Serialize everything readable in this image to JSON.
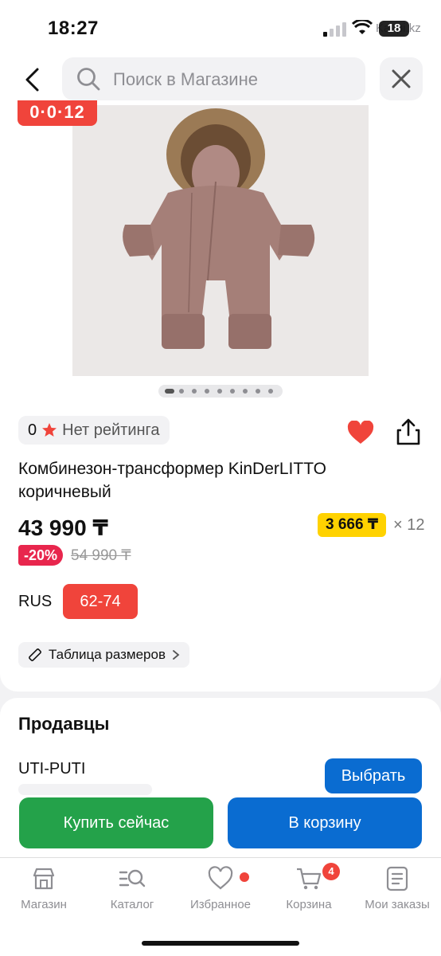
{
  "status_bar": {
    "time": "18:27",
    "carrier": "Kaspi.kz",
    "battery": "18"
  },
  "header": {
    "search_placeholder": "Поиск в Магазине"
  },
  "gallery": {
    "timer": "0·0·12",
    "photo_count": 9,
    "active_index": 0
  },
  "product": {
    "rating_value": "0",
    "rating_label": "Нет рейтинга",
    "title": "Комбинезон-трансформер KinDerLITTO коричневый",
    "price": "43 990 ₸",
    "installment": "3 666 ₸",
    "installment_times": "× 12",
    "discount": "-20%",
    "old_price": "54 990 ₸",
    "size_system": "RUS",
    "size_selected": "62-74",
    "size_table_label": "Таблица размеров",
    "favorited": true
  },
  "sellers": {
    "title": "Продавцы",
    "items": [
      {
        "name": "UTI-PUTI",
        "action": "Выбрать"
      }
    ]
  },
  "actions": {
    "buy_now": "Купить сейчас",
    "add_to_cart": "В корзину"
  },
  "tabbar": {
    "items": [
      {
        "label": "Магазин",
        "icon": "store-icon"
      },
      {
        "label": "Каталог",
        "icon": "catalog-search-icon"
      },
      {
        "label": "Избранное",
        "icon": "heart-outline-icon",
        "has_dot": true
      },
      {
        "label": "Корзина",
        "icon": "cart-icon",
        "badge": "4"
      },
      {
        "label": "Мои заказы",
        "icon": "orders-icon"
      }
    ]
  },
  "colors": {
    "accent_red": "#f0443b",
    "primary_blue": "#0a6cd1",
    "buy_green": "#24a24a",
    "installment_yellow": "#ffd200"
  }
}
